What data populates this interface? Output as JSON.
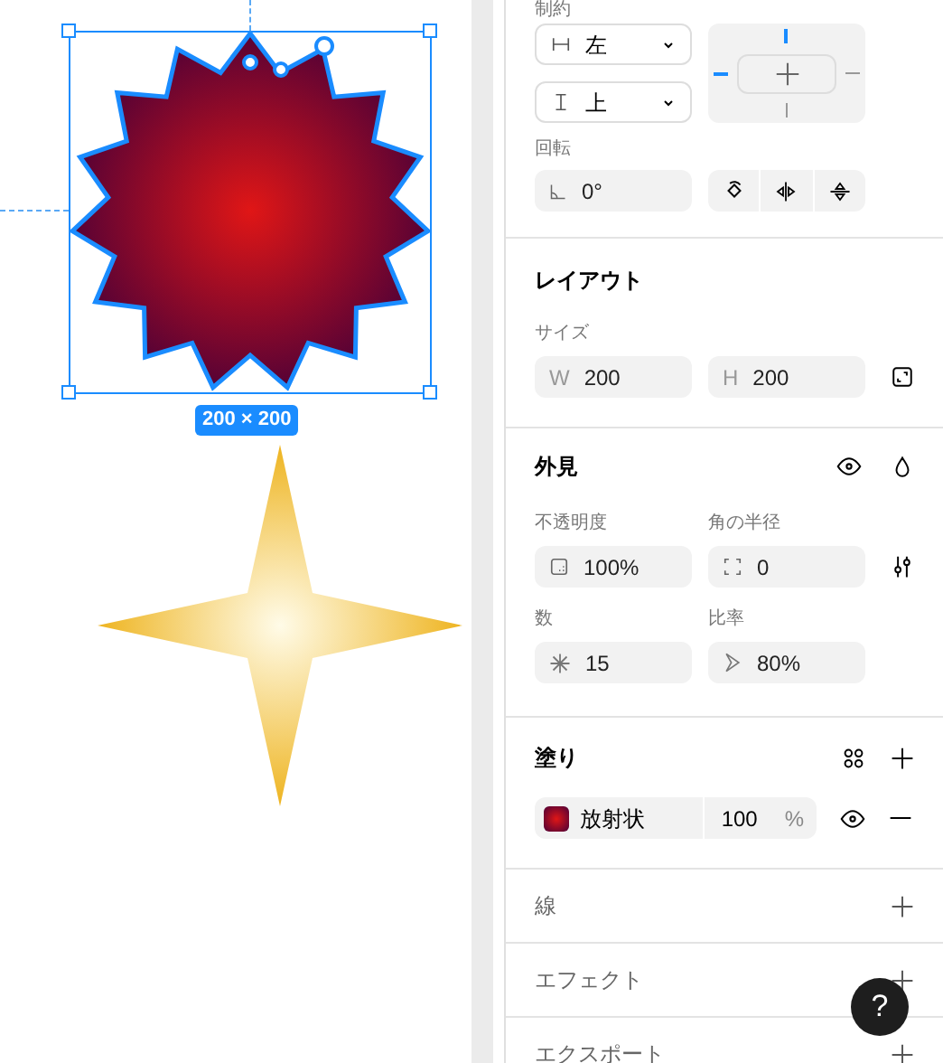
{
  "canvas": {
    "size_label": "200 × 200"
  },
  "constraints": {
    "label": "制約",
    "horizontal": "左",
    "vertical": "上",
    "pins": {
      "top": true,
      "left": true,
      "right": false,
      "bottom": false
    }
  },
  "rotation": {
    "label": "回転",
    "value": "0°"
  },
  "layout": {
    "title": "レイアウト",
    "size_label": "サイズ",
    "width": {
      "prefix": "W",
      "value": "200"
    },
    "height": {
      "prefix": "H",
      "value": "200"
    }
  },
  "appearance": {
    "title": "外見",
    "opacity": {
      "label": "不透明度",
      "value": "100%"
    },
    "radius": {
      "label": "角の半径",
      "value": "0"
    },
    "count": {
      "label": "数",
      "value": "15"
    },
    "ratio": {
      "label": "比率",
      "value": "80%"
    }
  },
  "fill": {
    "title": "塗り",
    "type": "放射状",
    "opacity": "100",
    "unit": "%"
  },
  "sections": [
    {
      "title": "線"
    },
    {
      "title": "エフェクト"
    },
    {
      "title": "エクスポート"
    }
  ],
  "help": "?"
}
